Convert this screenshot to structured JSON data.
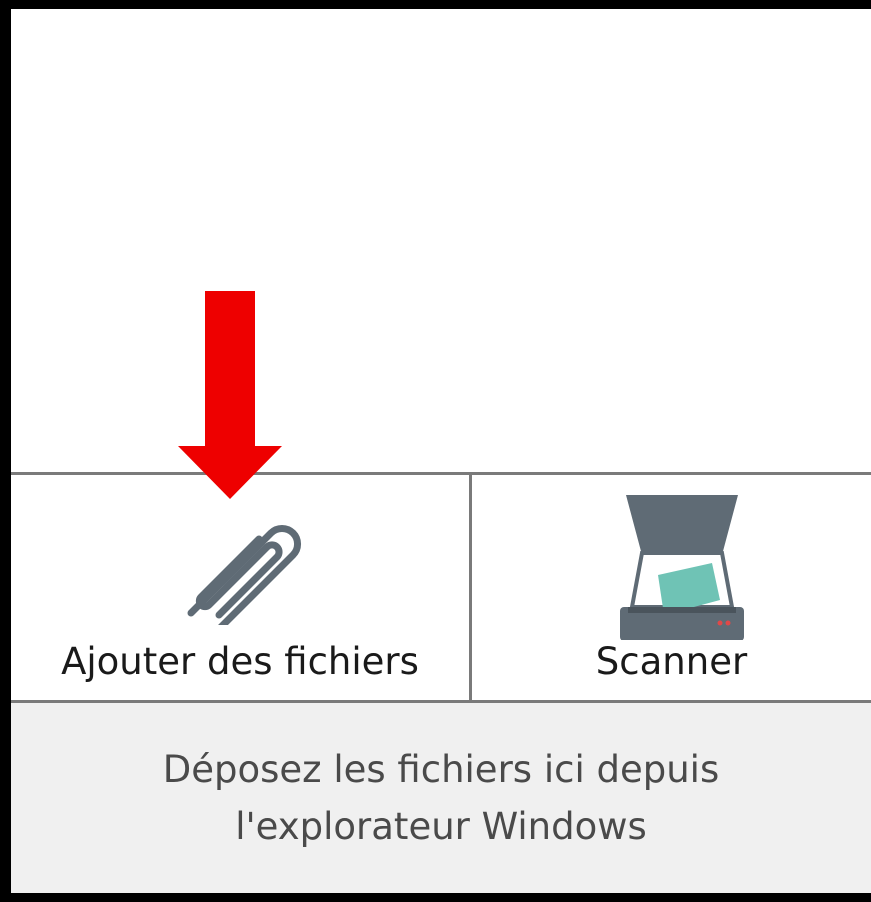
{
  "buttons": {
    "add_files_label": "Ajouter des fichiers",
    "scan_label": "Scanner"
  },
  "drop_zone": {
    "line1": "Déposez les fichiers ici depuis",
    "line2": "l'explorateur Windows"
  },
  "icons": {
    "add_files": "paperclip-icon",
    "scan": "scanner-icon",
    "annotation": "red-down-arrow"
  },
  "colors": {
    "arrow": "#ee0000",
    "icon_gray": "#5f6b75",
    "scan_sheet": "#6fc3b5",
    "drop_zone_bg": "#f0f0f0"
  }
}
